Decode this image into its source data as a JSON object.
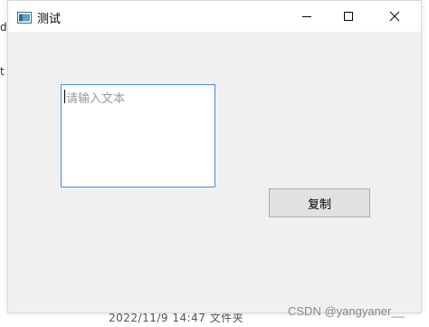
{
  "window": {
    "title": "测试",
    "icon": "window-app-icon",
    "controls": {
      "minimize_icon": "minimize-icon",
      "maximize_icon": "maximize-icon",
      "close_icon": "close-icon"
    }
  },
  "editor": {
    "placeholder": "请输入文本",
    "value": "",
    "border_color": "#4a90d9"
  },
  "actions": {
    "copy_label": "复制"
  },
  "background": {
    "fragment_1": "d",
    "fragment_2": "t",
    "bottom_fragment": "2022/11/9 14:47        文件夹"
  },
  "watermark": "CSDN @yangyaner__"
}
